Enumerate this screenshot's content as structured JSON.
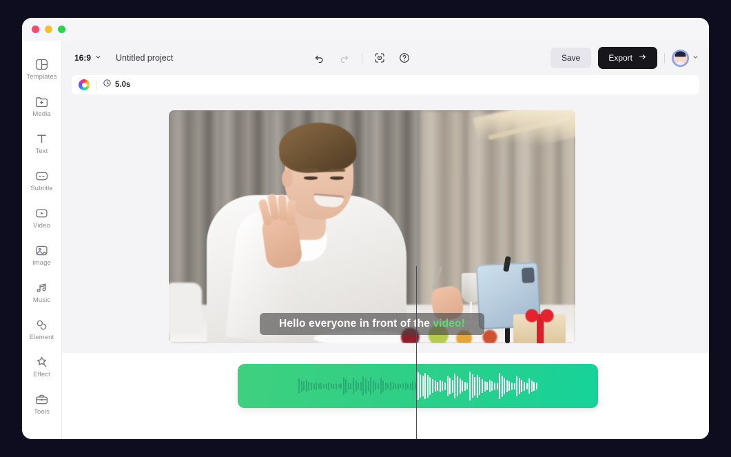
{
  "window": {
    "traffic_lights": [
      "close",
      "minimize",
      "maximize"
    ],
    "colors": {
      "close": "#f8486e",
      "minimize": "#f9bf26",
      "maximize": "#2bd44a"
    }
  },
  "sidebar": {
    "items": [
      {
        "label": "Templates",
        "icon": "templates-icon"
      },
      {
        "label": "Media",
        "icon": "media-folder-plus-icon"
      },
      {
        "label": "Text",
        "icon": "text-t-icon"
      },
      {
        "label": "Subtitle",
        "icon": "subtitle-icon"
      },
      {
        "label": "Video",
        "icon": "video-play-icon"
      },
      {
        "label": "Image",
        "icon": "image-picture-icon"
      },
      {
        "label": "Music",
        "icon": "music-notes-icon"
      },
      {
        "label": "Element",
        "icon": "element-shapes-icon"
      },
      {
        "label": "Effect",
        "icon": "effect-sparkle-icon"
      },
      {
        "label": "Tools",
        "icon": "tools-briefcase-icon"
      }
    ]
  },
  "toolbar": {
    "aspect_ratio": "16:9",
    "aspect_ratio_caret": "chevron-down-icon",
    "project_title": "Untitled project",
    "undo": "undo-icon",
    "redo": "redo-icon",
    "preview": "preview-frame-icon",
    "help": "help-question-icon",
    "save_label": "Save",
    "export_label": "Export",
    "export_arrow": "arrow-right-icon",
    "avatar": "user-avatar",
    "avatar_caret": "chevron-down-icon",
    "accent_dark": "#16161b",
    "save_bg": "#e6e6ec"
  },
  "subbar": {
    "color_wheel": "color-wheel-icon",
    "clock_icon": "clock-icon",
    "duration": "5.0s"
  },
  "canvas": {
    "subtitle_prefix": "Hello everyone in front of the ",
    "subtitle_highlight": "video!",
    "highlight_color": "#5ddb6d"
  },
  "timeline": {
    "clip_type": "audio-waveform-clip",
    "clip_color_start": "#3fd07f",
    "clip_color_end": "#16d29a",
    "playhead": "playhead-line",
    "waveform": {
      "total_bars": 96,
      "playhead_bar_index": 48,
      "heights": [
        22,
        17,
        14,
        18,
        13,
        11,
        9,
        12,
        8,
        10,
        7,
        9,
        11,
        8,
        7,
        9,
        6,
        8,
        26,
        20,
        11,
        9,
        24,
        16,
        10,
        13,
        28,
        22,
        15,
        26,
        19,
        12,
        9,
        24,
        17,
        11,
        8,
        13,
        10,
        7,
        9,
        6,
        8,
        11,
        7,
        9,
        14,
        10,
        40,
        34,
        30,
        38,
        33,
        26,
        20,
        16,
        13,
        18,
        14,
        11,
        30,
        24,
        19,
        36,
        29,
        22,
        16,
        13,
        10,
        42,
        34,
        27,
        33,
        26,
        20,
        15,
        12,
        18,
        14,
        11,
        9,
        38,
        31,
        24,
        18,
        14,
        11,
        9,
        30,
        24,
        18,
        13,
        10,
        22,
        17,
        13,
        10
      ]
    }
  }
}
